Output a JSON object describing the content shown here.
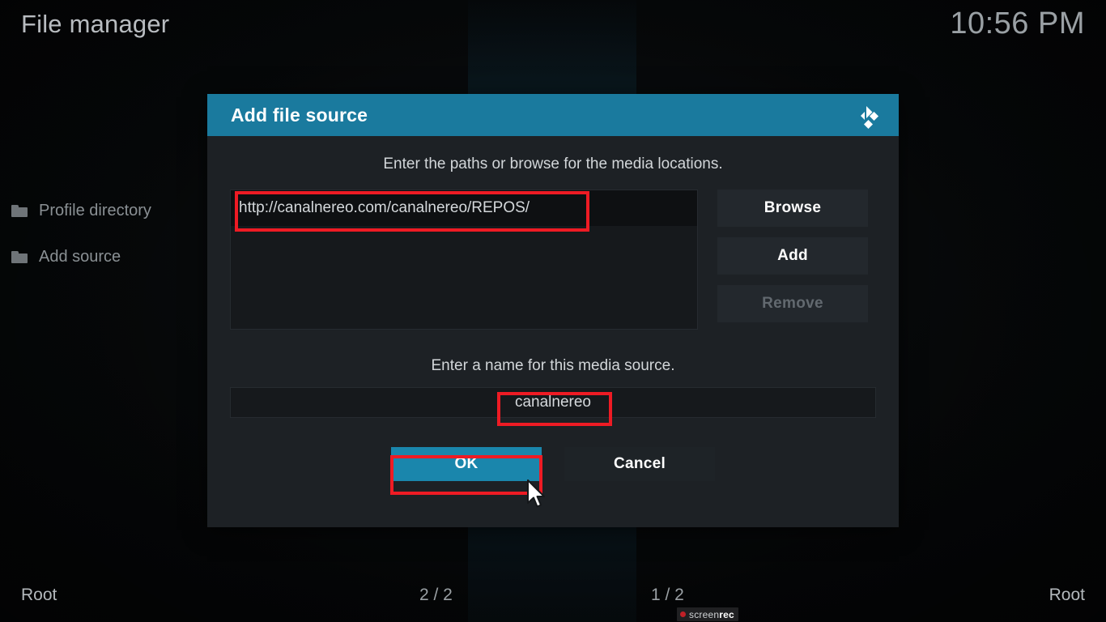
{
  "window": {
    "app_title": "File manager",
    "clock": "10:56 PM"
  },
  "sidebar": {
    "items": [
      {
        "label": "Profile directory",
        "icon": "folder-icon"
      },
      {
        "label": "Add source",
        "icon": "folder-icon"
      }
    ]
  },
  "dialog": {
    "title": "Add file source",
    "logo_icon": "kodi-logo-icon",
    "subtitle": "Enter the paths or browse for the media locations.",
    "path_entry": "http://canalnereo.com/canalnereo/REPOS/",
    "buttons": {
      "browse": "Browse",
      "add": "Add",
      "remove": "Remove"
    },
    "name_label": "Enter a name for this media source.",
    "name_value": "canalnereo",
    "actions": {
      "ok": "OK",
      "cancel": "Cancel"
    }
  },
  "statusbar": {
    "left_root": "Root",
    "left_count": "2 / 2",
    "right_count": "1 / 2",
    "right_root": "Root"
  },
  "watermark": {
    "text_light": "screen",
    "text_bold": "rec"
  },
  "colors": {
    "accent": "#1a7a9e",
    "accent_button": "#1a86ac",
    "annotation": "#ee1b24",
    "dialog_bg": "#1d2125",
    "field_bg": "#16191c",
    "button_bg": "#23282d",
    "text_primary": "#ffffff",
    "text_secondary": "#d2d6d9",
    "text_muted": "#8a9094",
    "text_disabled": "#62696f"
  }
}
